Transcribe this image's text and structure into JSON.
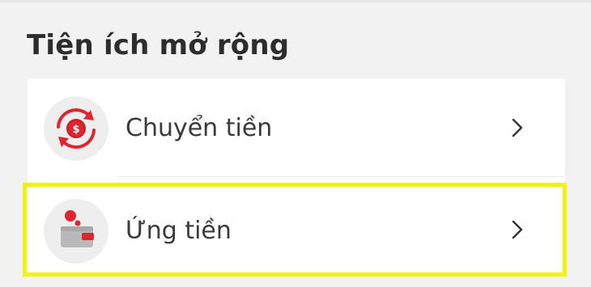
{
  "section": {
    "title": "Tiện ích mở rộng"
  },
  "items": [
    {
      "label": "Chuyển tiền",
      "icon": "money-transfer-icon"
    },
    {
      "label": "Ứng tiền",
      "icon": "wallet-icon"
    }
  ],
  "colors": {
    "accent": "#e0252e",
    "highlight": "#f5f20a",
    "icon_bg": "#eeeeee"
  }
}
